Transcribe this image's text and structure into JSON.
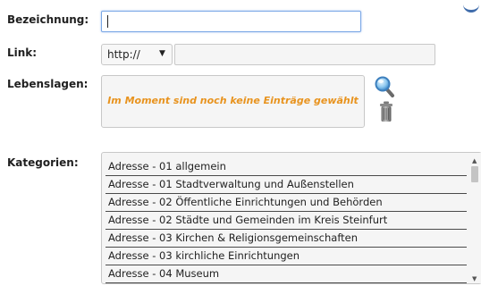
{
  "form": {
    "bezeichnung_label": "Bezeichnung:",
    "bezeichnung_value": "",
    "link_label": "Link:",
    "link_protocol": "http://",
    "link_url_value": "",
    "lebenslagen_label": "Lebenslagen:",
    "lebenslagen_empty": "Im Moment sind noch keine Einträge gewählt",
    "kategorien_label": "Kategorien:"
  },
  "kategorien": [
    "Adresse - 01 allgemein",
    "Adresse - 01 Stadtverwaltung und Außenstellen",
    "Adresse - 02 Öffentliche Einrichtungen und Behörden",
    "Adresse - 02 Städte und Gemeinden im Kreis Steinfurt",
    "Adresse - 03 Kirchen & Religionsgemeinschaften",
    "Adresse - 03 kirchliche Einrichtungen",
    "Adresse - 04 Museum"
  ],
  "icons": [
    "search-icon",
    "trash-icon",
    "chevron-down-icon"
  ],
  "colors": {
    "accent": "#e8931e",
    "focus_border": "#7aa7e6",
    "brand_blue": "#3f6cab"
  }
}
